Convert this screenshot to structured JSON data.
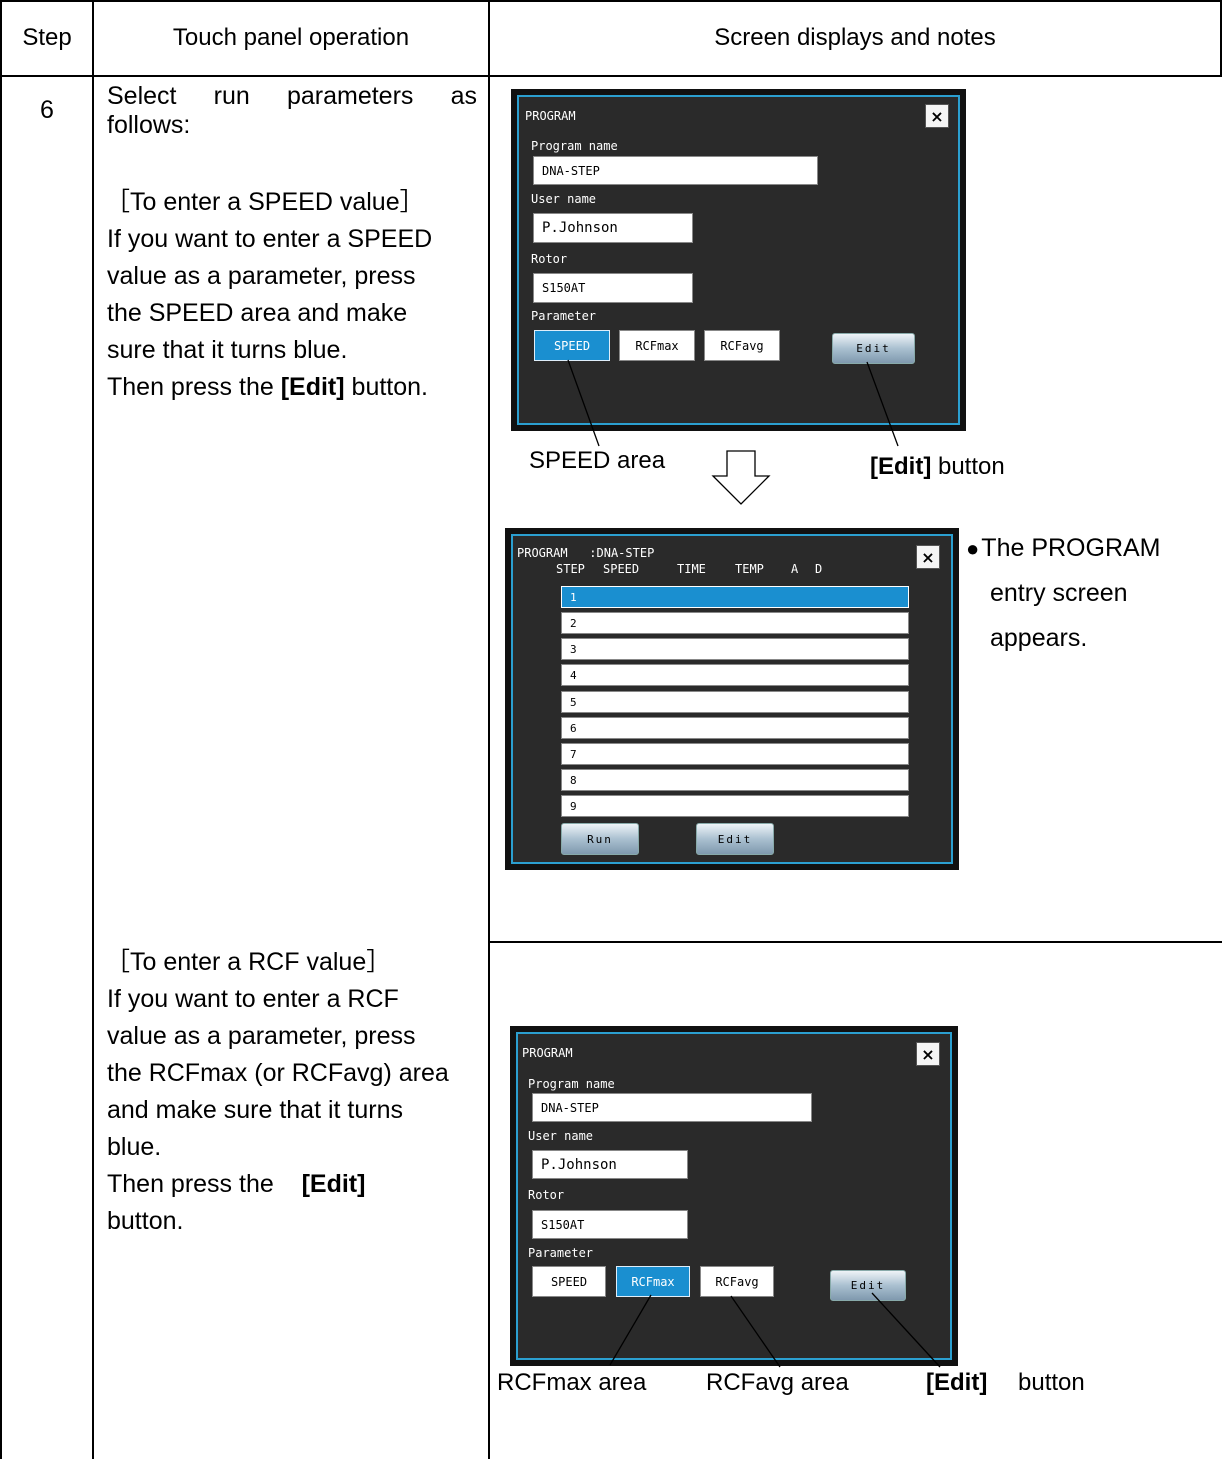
{
  "header": {
    "step": "Step",
    "operation": "Touch panel operation",
    "notes": "Screen displays and notes"
  },
  "row1": {
    "step_number": "6",
    "line1_words": [
      "Select",
      "run",
      "parameters",
      "as"
    ],
    "line2": "follows:",
    "speed_heading": "［To enter a SPEED value］",
    "speed_lines": [
      "If you want to enter a SPEED",
      "value as a parameter, press",
      "the SPEED area and make",
      "sure that it turns blue."
    ],
    "then_prefix": "Then press the ",
    "then_bold": "[Edit]",
    "then_suffix": " button."
  },
  "row2": {
    "rcf_heading": "［To enter a RCF value］",
    "rcf_lines": [
      "If you want to enter a RCF",
      "value as a parameter, press",
      "the RCFmax (or RCFavg) area",
      "and make sure that it turns",
      "blue."
    ],
    "then_prefix": "Then press the ",
    "then_bold": "[Edit]",
    "then_suffix": "button."
  },
  "screen1": {
    "title": "PROGRAM",
    "close": "×",
    "program_name_label": "Program name",
    "program_name": "DNA-STEP",
    "user_name_label": "User name",
    "user_name": "P.Johnson",
    "rotor_label": "Rotor",
    "rotor": "S150AT",
    "parameter_label": "Parameter",
    "params": [
      "SPEED",
      "RCFmax",
      "RCFavg"
    ],
    "edit": "Edit"
  },
  "screen2": {
    "title": "PROGRAM",
    "title_value": ":DNA-STEP",
    "close": "×",
    "columns": [
      "STEP",
      "SPEED",
      "TIME",
      "TEMP",
      "A",
      "D"
    ],
    "rows": [
      "1",
      "2",
      "3",
      "4",
      "5",
      "6",
      "7",
      "8",
      "9"
    ],
    "run": "Run",
    "edit": "Edit"
  },
  "screen3": {
    "title": "PROGRAM",
    "close": "×",
    "program_name_label": "Program name",
    "program_name": "DNA-STEP",
    "user_name_label": "User name",
    "user_name": "P.Johnson",
    "rotor_label": "Rotor",
    "rotor": "S150AT",
    "parameter_label": "Parameter",
    "params": [
      "SPEED",
      "RCFmax",
      "RCFavg"
    ],
    "edit": "Edit"
  },
  "callouts": {
    "speed_area": "SPEED area",
    "edit_bold": "[Edit]",
    "edit_button_suffix": " button",
    "bullet": "●",
    "program_note_lines": [
      "The PROGRAM",
      "entry screen",
      "appears."
    ],
    "rcfmax_area": "RCFmax area",
    "rcfavg_area": "RCFavg area",
    "edit_button_suffix2": "button"
  },
  "colors": {
    "selected_blue": "#1a8fd0",
    "frame_blue": "#2b9fd0",
    "screen_bg": "#2a2a2a"
  }
}
